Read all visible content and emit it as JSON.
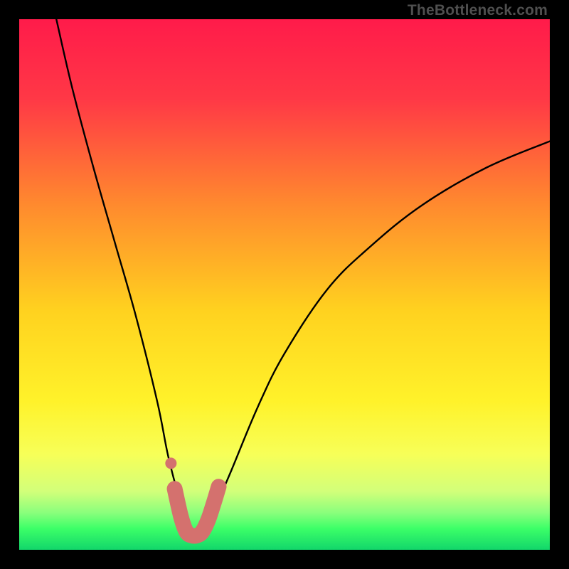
{
  "watermark": "TheBottleneck.com",
  "chart_data": {
    "type": "line",
    "title": "",
    "xlabel": "",
    "ylabel": "",
    "xlim": [
      0,
      100
    ],
    "ylim": [
      0,
      100
    ],
    "grid": false,
    "legend": "none",
    "series": [
      {
        "name": "bottleneck-curve",
        "x": [
          7,
          10,
          14,
          18,
          22,
          26,
          28,
          30,
          31,
          32.5,
          34,
          36,
          37,
          40,
          45,
          50,
          58,
          66,
          76,
          88,
          100
        ],
        "values": [
          100,
          87,
          72,
          58,
          44,
          28,
          18,
          10,
          5,
          2.6,
          2.6,
          5,
          8,
          15,
          27,
          37,
          49,
          57,
          65,
          72,
          77
        ]
      },
      {
        "name": "trough-marker",
        "x": [
          29.3,
          30.5,
          31.5,
          32.5,
          33.5,
          34.5,
          35.6,
          36.6,
          37.6
        ],
        "values": [
          11.5,
          6.2,
          3.4,
          2.7,
          2.7,
          3.4,
          5.6,
          8.6,
          11.9
        ]
      },
      {
        "name": "outlier-dot",
        "x": [
          28.6
        ],
        "values": [
          16.3
        ]
      }
    ],
    "colors": {
      "curve": "#000000",
      "marker": "#d4716e",
      "gradient": [
        "#ff1b4a",
        "#ff5240",
        "#ffae26",
        "#ffe820",
        "#f9ff4e",
        "#c6ff88",
        "#3cff68",
        "#12d66a"
      ]
    }
  }
}
